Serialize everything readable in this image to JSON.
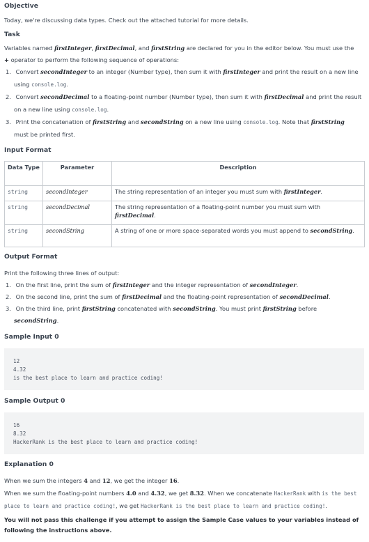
{
  "objective": {
    "heading": "Objective",
    "text": "Today, we're discussing data types. Check out the attached tutorial for more details."
  },
  "task": {
    "heading": "Task",
    "intro_1": "Variables named",
    "var_first_integer": "firstInteger",
    "var_first_decimal": "firstDecimal",
    "intro_and": "and",
    "var_first_string": "firstString",
    "intro_2": "are declared for you in the editor below. You must use the",
    "intro_3": "operator to perform the following sequence of operations:",
    "plus": "+",
    "steps": [
      {
        "num": "1.",
        "a": "Convert",
        "var": "secondInteger",
        "b": "to an integer (Number type), then sum it with",
        "var2": "firstInteger",
        "c": "and print the result on a new line",
        "d": "using",
        "code": "console.log",
        "e": "."
      },
      {
        "num": "2.",
        "a": "Convert",
        "var": "secondDecimal",
        "b": "to a floating-point number (Number type), then sum it with",
        "var2": "firstDecimal",
        "c": "and print the result",
        "d": "on a new line using",
        "code": "console.log",
        "e": "."
      },
      {
        "num": "3.",
        "a": "Print the concatenation of",
        "var": "firstString",
        "b": "and",
        "var2": "secondString",
        "c": "on a new line using",
        "code": "console.log",
        "d": ". Note that",
        "var3": "firstString",
        "e": "must be printed first."
      }
    ]
  },
  "input_format": {
    "heading": "Input Format",
    "columns": [
      "Data Type",
      "Parameter",
      "Description"
    ],
    "rows": [
      {
        "type": "string",
        "param": "secondInteger",
        "desc": "The string representation of an integer you must sum with",
        "desc_var": "firstInteger",
        "desc_end": "."
      },
      {
        "type": "string",
        "param": "secondDecimal",
        "desc": "The string representation of a floating-point number you must sum with",
        "desc_var": "firstDecimal",
        "desc_end": "."
      },
      {
        "type": "string",
        "param": "secondString",
        "desc": "A string of one or more space-separated words you must append to",
        "desc_var": "secondString",
        "desc_end": "."
      }
    ]
  },
  "output_format": {
    "heading": "Output Format",
    "intro": "Print the following three lines of output:",
    "items": [
      {
        "num": "1.",
        "a": "On the first line, print the sum of",
        "v1": "firstInteger",
        "b": "and the integer representation of",
        "v2": "secondInteger",
        "c": "."
      },
      {
        "num": "2.",
        "a": "On the second line, print the sum of",
        "v1": "firstDecimal",
        "b": "and the floating-point representation of",
        "v2": "secondDecimal",
        "c": "."
      },
      {
        "num": "3.",
        "a": "On the third line, print",
        "v1": "firstString",
        "b": "concatenated with",
        "v2": "secondString",
        "c": ". You must print",
        "v3": "firstString",
        "d": "before",
        "v4": "secondString",
        "e": "."
      }
    ]
  },
  "sample_input": {
    "heading": "Sample Input 0",
    "lines": [
      "12",
      "4.32",
      "is the best place to learn and practice coding!"
    ]
  },
  "sample_output": {
    "heading": "Sample Output 0",
    "lines": [
      "16",
      "8.32",
      "HackerRank is the best place to learn and practice coding!"
    ]
  },
  "explanation": {
    "heading": "Explanation 0",
    "line1_a": "When we sum the integers",
    "n4": "4",
    "line1_b": "and",
    "n12": "12",
    "line1_c": ", we get the integer",
    "n16": "16",
    "line1_d": ".",
    "line2_a": "When we sum the floating-point numbers",
    "n40": "4.0",
    "line2_b": "and",
    "n432": "4.32",
    "line2_c": ", we get",
    "n832": "8.32",
    "line2_d": ". When we concatenate",
    "code_hr": "HackerRank",
    "line2_e": "with",
    "code_is": "is the best",
    "code_place": "place to learn and practice coding!",
    "line3_a": ", we get",
    "code_full": "HackerRank is the best place to learn and practice coding!",
    "line3_b": ".",
    "warning": "You will not pass this challenge if you attempt to assign the Sample Case values to your variables instead of following the instructions above."
  }
}
